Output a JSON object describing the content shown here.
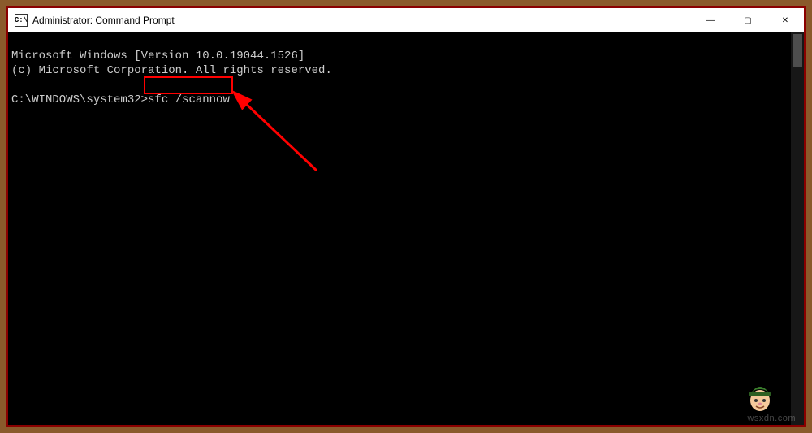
{
  "titlebar": {
    "icon_label": "C:\\",
    "title": "Administrator: Command Prompt",
    "minimize": "—",
    "maximize": "▢",
    "close": "✕"
  },
  "terminal": {
    "line1": "Microsoft Windows [Version 10.0.19044.1526]",
    "line2": "(c) Microsoft Corporation. All rights reserved.",
    "blank": "",
    "prompt": "C:\\WINDOWS\\system32>",
    "command": "sfc /scannow"
  },
  "annotation": {
    "highlight_color": "#ff0000"
  },
  "watermark": "wsxdn.com"
}
